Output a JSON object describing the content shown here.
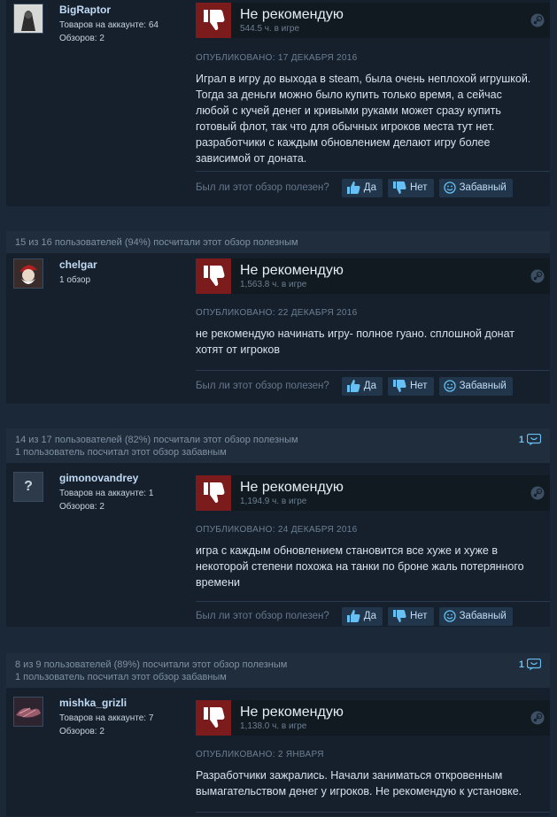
{
  "labels": {
    "helpful_question": "Был ли этот обзор полезен?",
    "yes": "Да",
    "no": "Нет",
    "funny": "Забавный"
  },
  "reviews": [
    {
      "header": [],
      "author": "BigRaptor",
      "meta": [
        "Товаров на аккаунте: 64",
        "Обзоров: 2"
      ],
      "verdict": "Не рекомендую",
      "hours": "544.5 ч. в игре",
      "posted": "ОПУБЛИКОВАНО: 17 ДЕКАБРЯ 2016",
      "text": "Играл в игру до выхода в steam, была очень неплохой игрушкой. Тогда за деньги можно было купить только время, а сейчас любой с кучей денег и кривыми руками может сразу купить готовый флот, так что для обычных игроков места тут нет. разработчики с каждым обновлением делают игру более зависимой от доната."
    },
    {
      "header": [
        "15 из 16 пользователей (94%) посчитали этот обзор полезным"
      ],
      "funny_count": "",
      "author": "chelgar",
      "meta": [
        "1 обзор"
      ],
      "verdict": "Не рекомендую",
      "hours": "1,563.8 ч. в игре",
      "posted": "ОПУБЛИКОВАНО: 22 ДЕКАБРЯ 2016",
      "text": "не рекомендую начинать игру- полное гуано. сплошной донат хотят от игроков"
    },
    {
      "header": [
        "14 из 17 пользователей (82%) посчитали этот обзор полезным",
        "1 пользователь посчитал этот обзор забавным"
      ],
      "funny_count": "1",
      "author": "gimonovandrey",
      "meta": [
        "Товаров на аккаунте: 1",
        "Обзоров: 2"
      ],
      "verdict": "Не рекомендую",
      "hours": "1,194.9 ч. в игре",
      "posted": "ОПУБЛИКОВАНО: 24 ДЕКАБРЯ 2016",
      "text": "игра с каждым обновлением становится все хуже и хуже в некоторой степени похожа на танки по броне жаль потерянного времени"
    },
    {
      "header": [
        "8 из 9 пользователей (89%) посчитали этот обзор полезным",
        "1 пользователь посчитал этот обзор забавным"
      ],
      "funny_count": "1",
      "author": "mishka_grizli",
      "meta": [
        "Товаров на аккаунте: 7",
        "Обзоров: 2"
      ],
      "verdict": "Не рекомендую",
      "hours": "1,138.0 ч. в игре",
      "posted": "ОПУБЛИКОВАНО: 2 ЯНВАРЯ",
      "text": "Разработчики зажрались. Начали заниматься откровенным вымагательством денег у игроков. Не рекомендую к установке."
    }
  ]
}
